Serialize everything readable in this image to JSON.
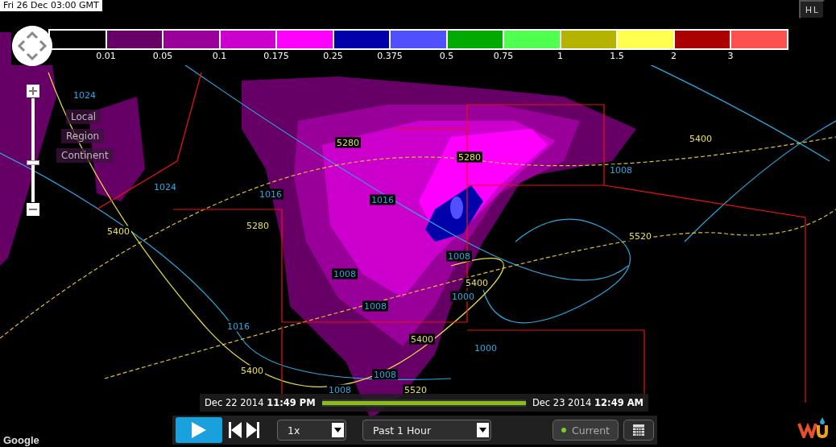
{
  "timestamp": "Fri 26 Dec  03:00 GMT",
  "legend": {
    "swatches": [
      {
        "color": "#000000"
      },
      {
        "color": "#660066"
      },
      {
        "color": "#990099"
      },
      {
        "color": "#cc00cc"
      },
      {
        "color": "#ff00ff"
      },
      {
        "color": "#0000aa"
      },
      {
        "color": "#5050ff"
      },
      {
        "color": "#00aa00"
      },
      {
        "color": "#50ff50"
      },
      {
        "color": "#b4b400"
      },
      {
        "color": "#ffff50"
      },
      {
        "color": "#aa0000"
      },
      {
        "color": "#ff5050"
      }
    ],
    "labels": [
      "0.01",
      "0.05",
      "0.1",
      "0.175",
      "0.25",
      "0.375",
      "0.5",
      "0.75",
      "1",
      "1.5",
      "2",
      "3"
    ]
  },
  "hl_button": {
    "top": "H",
    "bottom": "L"
  },
  "zoom_slider": {
    "level": 0.37
  },
  "zoom_presets": [
    "Local",
    "Region",
    "Continent"
  ],
  "contour_labels": [
    {
      "text": "1024",
      "kind": "pressure"
    },
    {
      "text": "5280",
      "kind": "thickness"
    },
    {
      "text": "5280",
      "kind": "thickness"
    },
    {
      "text": "1016",
      "kind": "pressure"
    },
    {
      "text": "1008",
      "kind": "pressure"
    },
    {
      "text": "5400",
      "kind": "thickness"
    },
    {
      "text": "1024",
      "kind": "pressure"
    },
    {
      "text": "1016",
      "kind": "pressure"
    },
    {
      "text": "5280",
      "kind": "thickness"
    },
    {
      "text": "5400",
      "kind": "thickness"
    },
    {
      "text": "5520",
      "kind": "thickness"
    },
    {
      "text": "1008",
      "kind": "pressure"
    },
    {
      "text": "5400",
      "kind": "thickness"
    },
    {
      "text": "1008",
      "kind": "pressure"
    },
    {
      "text": "1008",
      "kind": "pressure"
    },
    {
      "text": "1000",
      "kind": "pressure"
    },
    {
      "text": "1016",
      "kind": "pressure"
    },
    {
      "text": "5400",
      "kind": "thickness"
    },
    {
      "text": "1000",
      "kind": "pressure"
    },
    {
      "text": "5400",
      "kind": "thickness"
    },
    {
      "text": "1008",
      "kind": "pressure"
    },
    {
      "text": "1008",
      "kind": "pressure"
    },
    {
      "text": "5520",
      "kind": "thickness"
    }
  ],
  "timeline": {
    "start": "Dec 22 2014 **11:49 PM**",
    "end": "Dec 23 2014 **12:49 AM**",
    "level": 1.0
  },
  "controls": {
    "speed": "1x",
    "range": "Past 1 Hour",
    "current": "Current",
    "current_on": true
  },
  "attribution": "Google"
}
